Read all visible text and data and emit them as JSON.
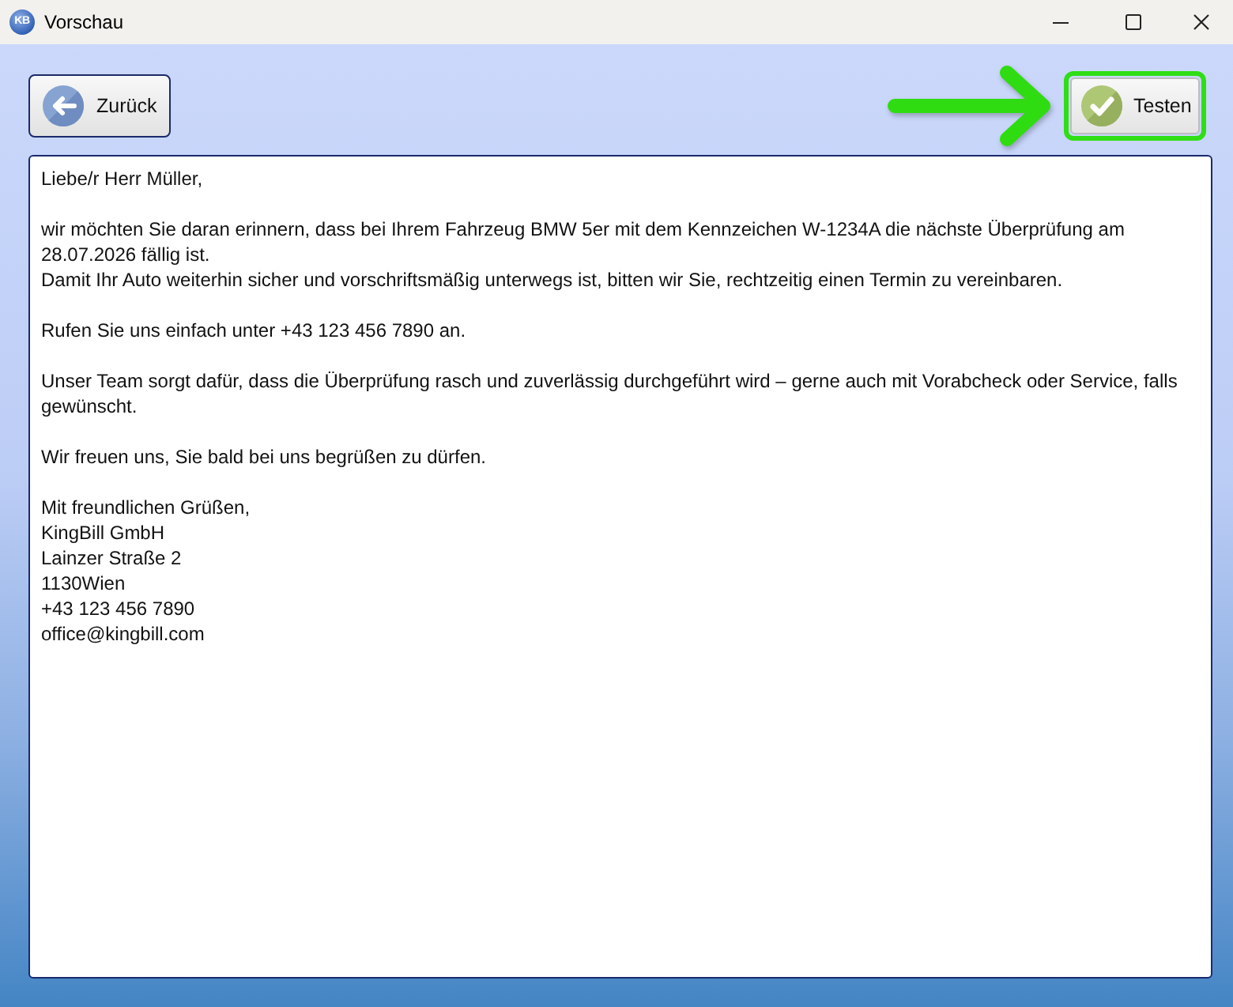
{
  "window": {
    "icon_label": "KB",
    "title": "Vorschau",
    "controls": [
      {
        "kind": "minimize"
      },
      {
        "kind": "maximize"
      },
      {
        "kind": "close"
      }
    ]
  },
  "toolbar": {
    "back_button": {
      "label": "Zurück"
    },
    "test_button": {
      "label": "Testen",
      "highlighted": true
    }
  },
  "message": {
    "paragraphs": [
      [
        "Liebe/r Herr Müller,"
      ],
      [
        "wir möchten Sie daran erinnern, dass bei Ihrem Fahrzeug BMW 5er mit dem Kennzeichen W-1234A die nächste Überprüfung am 28.07.2026 fällig ist.",
        "Damit Ihr Auto weiterhin sicher und vorschriftsmäßig unterwegs ist, bitten wir Sie, rechtzeitig einen Termin zu vereinbaren."
      ],
      [
        "Rufen Sie uns einfach unter +43 123 456 7890 an."
      ],
      [
        "Unser Team sorgt dafür, dass die Überprüfung rasch und zuverlässig durchgeführt wird – gerne auch mit Vorabcheck oder Service, falls gewünscht."
      ],
      [
        "Wir freuen uns, Sie bald bei uns begrüßen zu dürfen."
      ],
      [
        "Mit freundlichen Grüßen,",
        "KingBill GmbH",
        "Lainzer Straße 2",
        "1130Wien",
        "+43 123 456 7890",
        "office@kingbill.com"
      ]
    ]
  }
}
